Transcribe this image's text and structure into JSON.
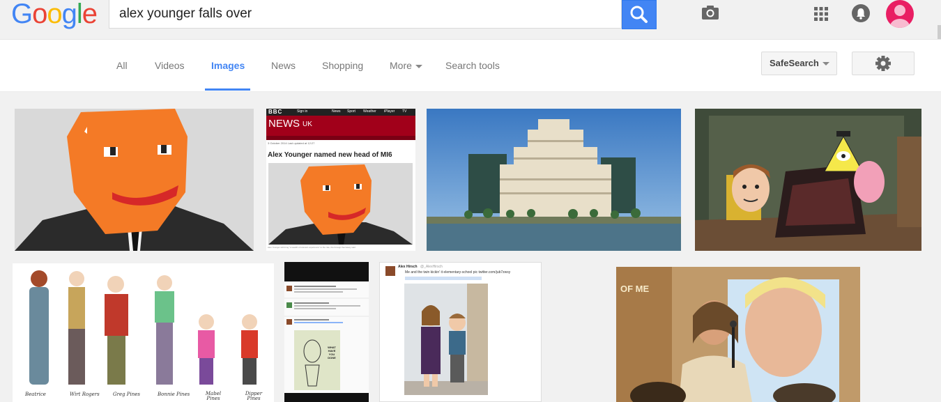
{
  "logo": {
    "letters": [
      "G",
      "o",
      "o",
      "g",
      "l",
      "e"
    ],
    "colors": [
      "#4285f4",
      "#ea4335",
      "#fbbc05",
      "#4285f4",
      "#34a853",
      "#ea4335"
    ]
  },
  "search": {
    "query": "alex younger falls over"
  },
  "tabs": [
    {
      "label": "All"
    },
    {
      "label": "Videos"
    },
    {
      "label": "Images"
    },
    {
      "label": "News"
    },
    {
      "label": "Shopping"
    },
    {
      "label": "More"
    },
    {
      "label": "Search tools"
    }
  ],
  "safesearch": {
    "label": "SafeSearch"
  },
  "thumbs": {
    "bbc": {
      "brand": "BBC",
      "nav_signin": "Sign in",
      "nav_news": "News",
      "nav_sport": "Sport",
      "nav_weather": "Weather",
      "nav_iplayer": "iPlayer",
      "nav_tv": "TV",
      "section": "NEWS",
      "region": "UK",
      "date": "3 October 2014 Last updated at 12:27",
      "headline": "Alex Younger named new head of MI6",
      "caption": "Alex Younger will bring \"a wealth of relevant experience\" to the role, the Foreign Secretary said"
    },
    "drawing_names": [
      "Beatrice",
      "Wirt Rogers",
      "Greg Pines",
      "Bonnie Pines",
      "Mabel Pines",
      "Dipper Pines"
    ],
    "tweet1": {
      "author": "Alex Hirsch",
      "handle": "@_AlexHirsch",
      "text": "Me and the twin kickin' it elementary-school pic twitter.com/jub7zwsy"
    },
    "small_tweet": {
      "sketch_text": "WHAT HAVE YOU DONE"
    },
    "photo": {
      "banner": "OF ME"
    }
  },
  "colors": {
    "accent": "#4285f4",
    "avatar": "#e91e63"
  }
}
